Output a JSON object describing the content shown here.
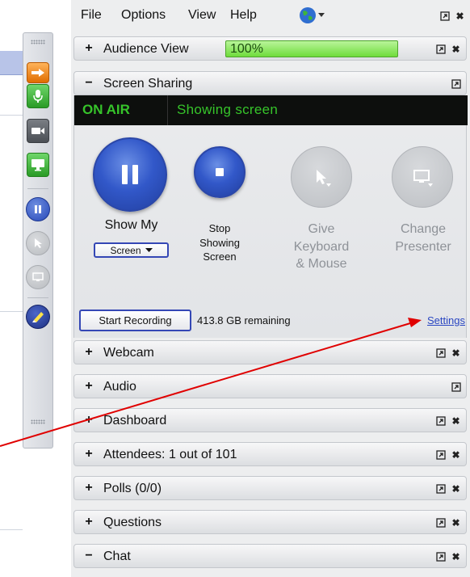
{
  "menubar": {
    "items": [
      "File",
      "Options",
      "View",
      "Help"
    ],
    "globe_icon": "globe-icon"
  },
  "audience_view": {
    "sign": "+",
    "title": "Audience View",
    "zoom": "100%"
  },
  "screen_sharing": {
    "sign": "−",
    "title": "Screen Sharing",
    "on_air": "ON AIR",
    "status": "Showing screen",
    "show_my": {
      "line1": "Show My",
      "dropdown": "Screen"
    },
    "stop": {
      "line1": "Stop",
      "line2": "Showing",
      "line3": "Screen"
    },
    "give": {
      "line1": "Give",
      "line2": "Keyboard",
      "line3": "& Mouse"
    },
    "change": {
      "line1": "Change",
      "line2": "Presenter"
    },
    "start_recording": "Start Recording",
    "remaining": "413.8 GB remaining",
    "settings": "Settings"
  },
  "sections": [
    {
      "sign": "+",
      "title": "Webcam",
      "close": true
    },
    {
      "sign": "+",
      "title": "Audio",
      "close": false
    },
    {
      "sign": "+",
      "title": "Dashboard",
      "close": true
    },
    {
      "sign": "+",
      "title": "Attendees:  1 out of 101",
      "close": true
    },
    {
      "sign": "+",
      "title": "Polls (0/0)",
      "close": true
    },
    {
      "sign": "+",
      "title": "Questions",
      "close": true
    },
    {
      "sign": "−",
      "title": "Chat",
      "close": true
    }
  ],
  "colors": {
    "accent_blue": "#3258c9",
    "on_air_green": "#36c42a",
    "meter_green": "#6fdc3c",
    "arrow_red": "#e00000",
    "link_blue": "#2a46c2"
  }
}
